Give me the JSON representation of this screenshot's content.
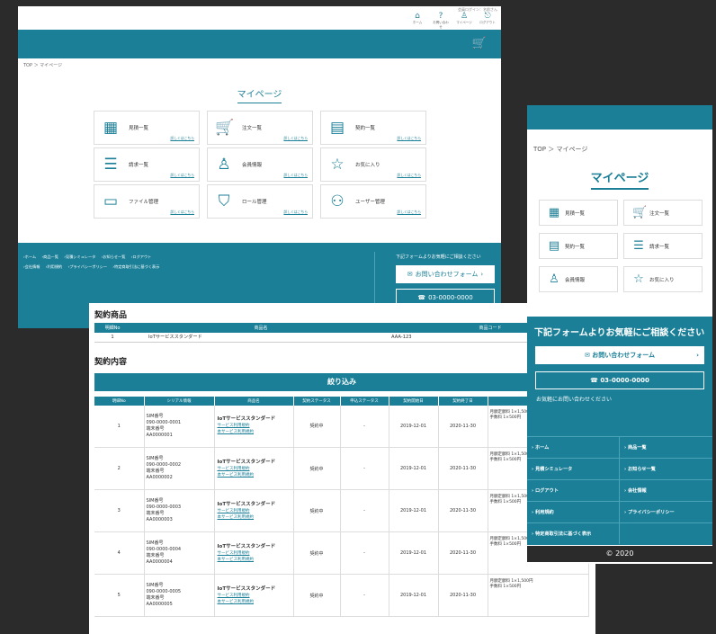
{
  "desktop": {
    "top_tiny": "会員ログイン：名前さん",
    "top_icons": [
      {
        "icon": "home-icon",
        "glyph": "⌂",
        "label": "ホーム"
      },
      {
        "icon": "help-icon",
        "glyph": "?",
        "label": "お問い合わせ"
      },
      {
        "icon": "user-icon",
        "glyph": "♙",
        "label": "マイページ"
      },
      {
        "icon": "logout-icon",
        "glyph": "⎋",
        "label": "ログアウト"
      }
    ],
    "breadcrumb": "TOP ＞ マイページ",
    "title": "マイページ",
    "cards": [
      {
        "label": "見積一覧",
        "link": "詳しくはこちら",
        "icon": "calculator-icon",
        "glyph": "▦"
      },
      {
        "label": "注文一覧",
        "link": "詳しくはこちら",
        "icon": "cart-icon",
        "glyph": "🛒"
      },
      {
        "label": "契約一覧",
        "link": "詳しくはこちら",
        "icon": "document-icon",
        "glyph": "▤"
      },
      {
        "label": "請求一覧",
        "link": "詳しくはこちら",
        "icon": "invoice-icon",
        "glyph": "☰"
      },
      {
        "label": "会員情報",
        "link": "詳しくはこちら",
        "icon": "person-icon",
        "glyph": "♙"
      },
      {
        "label": "お気に入り",
        "link": "詳しくはこちら",
        "icon": "star-icon",
        "glyph": "☆"
      },
      {
        "label": "ファイル管理",
        "link": "詳しくはこちら",
        "icon": "folder-icon",
        "glyph": "▭"
      },
      {
        "label": "ロール管理",
        "link": "詳しくはこちら",
        "icon": "shield-icon",
        "glyph": "⛉"
      },
      {
        "label": "ユーザー管理",
        "link": "詳しくはこちら",
        "icon": "users-icon",
        "glyph": "⚇"
      }
    ],
    "footer_links_row1": [
      "›ホーム",
      "›商品一覧",
      "›見積シミュレータ",
      "›お知らせ一覧",
      "›ログアウト"
    ],
    "footer_links_row2": [
      "›会社情報",
      "›利用規約",
      "›プライバシーポリシー",
      "›特定商取引法に基づく表示"
    ],
    "cta_text": "下記フォームよりお気軽にご相談ください",
    "form_button": "お問い合わせフォーム",
    "phone": "03-0000-0000"
  },
  "contract": {
    "products_title": "契約商品",
    "products_headers": [
      "明細No",
      "商品名",
      "商品コード"
    ],
    "products_rows": [
      [
        "1",
        "IoTサービススタンダード",
        "AAA-123"
      ]
    ],
    "details_title": "契約内容",
    "filter_button": "絞り込み",
    "headers": [
      "明細No",
      "シリアル情報",
      "商品名",
      "契約ステータス",
      "申込ステータス",
      "契約開始日",
      "契約終了日",
      ""
    ],
    "rows": [
      {
        "no": "1",
        "sim_label": "SIM番号",
        "sim": "090-0000-0001",
        "device_label": "端末番号",
        "device": "AA0000001",
        "product": "IoTサービススタンダード",
        "link1": "サービス利用規約",
        "link2": "本サービス利用規約",
        "status": "契約中",
        "apply": "-",
        "start": "2019-12-01",
        "end": "2020-11-30",
        "price1": "月額定額料 1×1,500円",
        "price2": "手数料 1×500円"
      },
      {
        "no": "2",
        "sim_label": "SIM番号",
        "sim": "090-0000-0002",
        "device_label": "端末番号",
        "device": "AA0000002",
        "product": "IoTサービススタンダード",
        "link1": "サービス利用規約",
        "link2": "本サービス利用規約",
        "status": "契約中",
        "apply": "-",
        "start": "2019-12-01",
        "end": "2020-11-30",
        "price1": "月額定額料 1×1,500円",
        "price2": "手数料 1×500円"
      },
      {
        "no": "3",
        "sim_label": "SIM番号",
        "sim": "090-0000-0003",
        "device_label": "端末番号",
        "device": "AA0000003",
        "product": "IoTサービススタンダード",
        "link1": "サービス利用規約",
        "link2": "本サービス利用規約",
        "status": "契約中",
        "apply": "-",
        "start": "2019-12-01",
        "end": "2020-11-30",
        "price1": "月額定額料 1×1,500円",
        "price2": "手数料 1×500円"
      },
      {
        "no": "4",
        "sim_label": "SIM番号",
        "sim": "090-0000-0004",
        "device_label": "端末番号",
        "device": "AA0000004",
        "product": "IoTサービススタンダード",
        "link1": "サービス利用規約",
        "link2": "本サービス利用規約",
        "status": "契約中",
        "apply": "-",
        "start": "2019-12-01",
        "end": "2020-11-30",
        "price1": "月額定額料 1×1,500円",
        "price2": "手数料 1×500円"
      },
      {
        "no": "5",
        "sim_label": "SIM番号",
        "sim": "090-0000-0005",
        "device_label": "端末番号",
        "device": "AA0000005",
        "product": "IoTサービススタンダード",
        "link1": "サービス利用規約",
        "link2": "本サービス利用規約",
        "status": "契約中",
        "apply": "-",
        "start": "2019-12-01",
        "end": "2020-11-30",
        "price1": "月額定額料 1×1,500円",
        "price2": "手数料 1×500円"
      }
    ]
  },
  "mobile": {
    "breadcrumb": "TOP ＞ マイページ",
    "title": "マイページ",
    "cards": [
      {
        "label": "見積一覧",
        "icon": "calculator-icon",
        "glyph": "▦"
      },
      {
        "label": "注文一覧",
        "icon": "cart-icon",
        "glyph": "🛒"
      },
      {
        "label": "契約一覧",
        "icon": "document-icon",
        "glyph": "▤"
      },
      {
        "label": "請求一覧",
        "icon": "invoice-icon",
        "glyph": "☰"
      },
      {
        "label": "会員情報",
        "icon": "person-icon",
        "glyph": "♙"
      },
      {
        "label": "お気に入り",
        "icon": "star-icon",
        "glyph": "☆"
      }
    ],
    "cta_text": "下記フォームよりお気軽にご相談ください",
    "form_button": "お問い合わせフォーム",
    "phone": "03-0000-0000",
    "note": "お気軽にお問い合わせください",
    "links": [
      "› ホーム",
      "› 商品一覧",
      "› 見積シミュレータ",
      "› お知らせ一覧",
      "› ログアウト",
      "› 会社情報",
      "› 利用規約",
      "› プライバシーポリシー",
      "› 特定商取引法に基づく表示",
      ""
    ],
    "copyright": "© 2020"
  }
}
